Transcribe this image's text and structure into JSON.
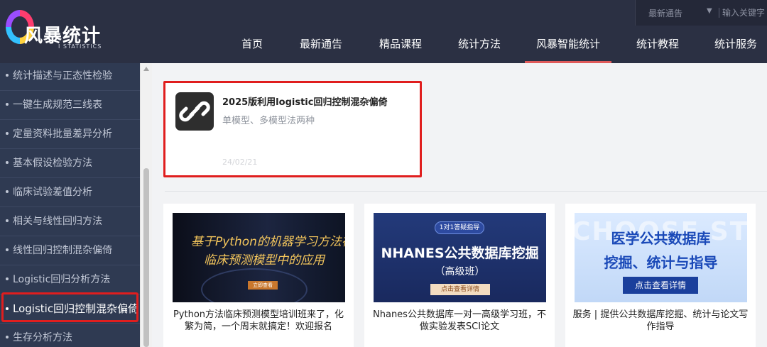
{
  "header": {
    "logo_title": "风暴统计",
    "logo_subtitle": "I STATISTICS",
    "topbar": {
      "notice": "最新通告",
      "search_placeholder": "输入关键字"
    },
    "nav": [
      {
        "label": "首页",
        "active": false
      },
      {
        "label": "最新通告",
        "active": false
      },
      {
        "label": "精品课程",
        "active": false
      },
      {
        "label": "统计方法",
        "active": false
      },
      {
        "label": "风暴智能统计",
        "active": true
      },
      {
        "label": "统计教程",
        "active": false
      },
      {
        "label": "统计服务",
        "active": false
      }
    ]
  },
  "sidebar": {
    "items": [
      {
        "label": "统计描述与正态性检验"
      },
      {
        "label": "一键生成规范三线表"
      },
      {
        "label": "定量资料批量差异分析"
      },
      {
        "label": "基本假设检验方法"
      },
      {
        "label": "临床试验差值分析"
      },
      {
        "label": "相关与线性回归方法"
      },
      {
        "label": "线性回归控制混杂偏倚"
      },
      {
        "label": "Logistic回归分析方法"
      },
      {
        "label": "Logistic回归控制混杂偏倚",
        "active": true
      },
      {
        "label": "生存分析方法"
      }
    ]
  },
  "featured": {
    "icon": "link-icon",
    "title": "2025版利用logistic回归控制混杂偏倚",
    "subtitle": "单模型、多模型法两种",
    "date": "24/02/21"
  },
  "cards": [
    {
      "banner": {
        "line1": "基于Python的机器学习方法在",
        "line2": "临床预测模型中的应用",
        "button": "立即查看"
      },
      "caption": "Python方法临床预测模型培训班来了，化繁为简，一个周末就搞定！欢迎报名"
    },
    {
      "banner": {
        "pill": "1对1答疑指导",
        "title": "NHANES公共数据库挖掘",
        "level": "（高级班）",
        "button": "点击查看详情"
      },
      "caption": "Nhanes公共数据库一对一高级学习班，不做实验发表SCI论文"
    },
    {
      "banner": {
        "watermark": "CHOOSE ST",
        "line1": "医学公共数据库",
        "line2": "挖掘、统计与指导",
        "button": "点击查看详情"
      },
      "caption": "服务 | 提供公共数据库挖掘、统计与论文写作指导"
    }
  ],
  "colors": {
    "header_bg": "#2b3043",
    "sidebar_bg": "#2f3a52",
    "highlight_red": "#e01e1e",
    "nav_underline": "#e05a5a"
  }
}
